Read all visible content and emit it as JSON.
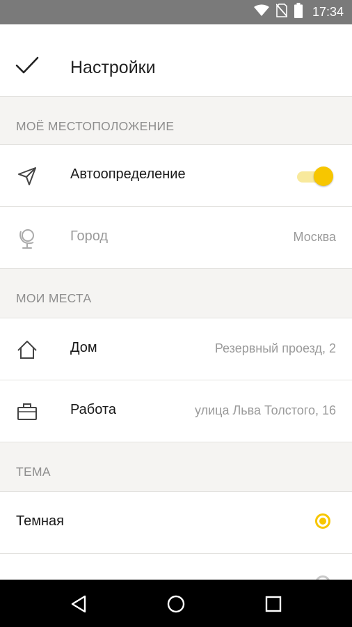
{
  "status_bar": {
    "time": "17:34",
    "icons": [
      "wifi-icon",
      "no-sim-icon",
      "battery-icon"
    ]
  },
  "header": {
    "title": "Настройки",
    "done_icon": "check-icon"
  },
  "sections": {
    "location": {
      "title": "МОЁ МЕСТОПОЛОЖЕНИЕ",
      "autodetect": {
        "label": "Автоопределение",
        "icon": "navigation-arrow-icon",
        "enabled": true
      },
      "city": {
        "label": "Город",
        "value": "Москва",
        "icon": "globe-icon"
      }
    },
    "places": {
      "title": "МОИ МЕСТА",
      "home": {
        "label": "Дом",
        "value": "Резервный проезд, 2",
        "icon": "home-icon"
      },
      "work": {
        "label": "Работа",
        "value": "улица Льва Толстого, 16",
        "icon": "briefcase-icon"
      }
    },
    "theme": {
      "title": "ТЕМА",
      "options": [
        {
          "label": "Темная",
          "selected": true
        }
      ]
    }
  },
  "nav_bar": {
    "buttons": [
      "back-icon",
      "home-circle-icon",
      "recents-icon"
    ]
  },
  "colors": {
    "accent": "#f7c600",
    "accent_light": "#f8e99c",
    "background": "#f5f4f2"
  }
}
